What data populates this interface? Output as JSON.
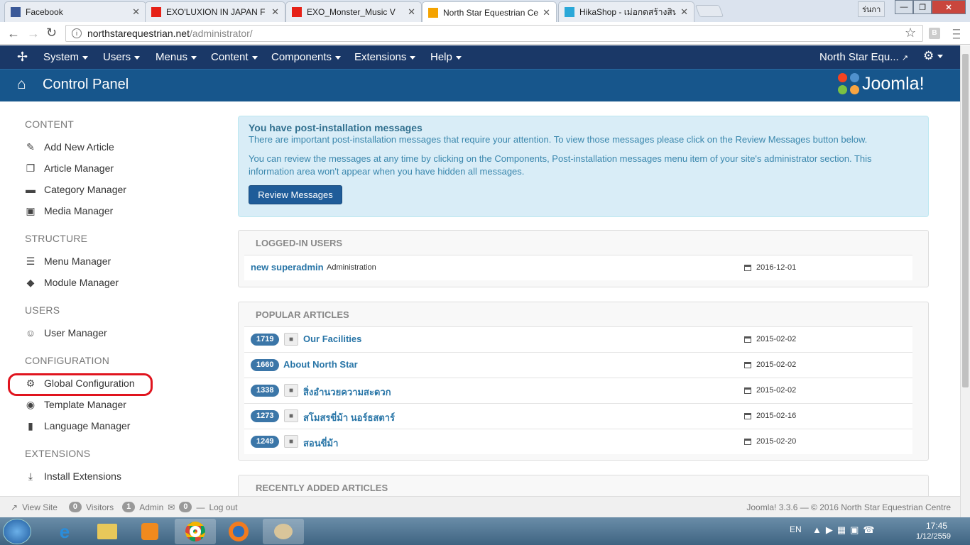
{
  "browser": {
    "tabs": [
      {
        "title": "Facebook",
        "icon": "facebook-icon",
        "color": "#3b5998"
      },
      {
        "title": "EXO'LUXION IN JAPAN F",
        "icon": "youtube-icon",
        "color": "#e62117"
      },
      {
        "title": "EXO_Monster_Music V",
        "icon": "youtube-icon",
        "color": "#e62117"
      },
      {
        "title": "North Star Equestrian Ce",
        "icon": "joomla-icon",
        "color": "#f4a300"
      },
      {
        "title": "HikaShop - เม่อกดสร้างสินค",
        "icon": "hikashop-icon",
        "color": "#2aa8d8"
      }
    ],
    "window_label": "ร่นกา",
    "url": "northstarequestrian.net",
    "url_path": "/administrator/"
  },
  "joomla": {
    "menu": [
      "System",
      "Users",
      "Menus",
      "Content",
      "Components",
      "Extensions",
      "Help"
    ],
    "site_name": "North Star Equ...",
    "page_title": "Control Panel",
    "logo_text": "Joomla!",
    "brand_color": "#1a3867"
  },
  "sidebar": {
    "sections": [
      {
        "heading": "CONTENT",
        "items": [
          {
            "label": "Add New Article",
            "icon": "pencil-icon"
          },
          {
            "label": "Article Manager",
            "icon": "copy-icon"
          },
          {
            "label": "Category Manager",
            "icon": "folder-icon"
          },
          {
            "label": "Media Manager",
            "icon": "image-icon"
          }
        ]
      },
      {
        "heading": "STRUCTURE",
        "items": [
          {
            "label": "Menu Manager",
            "icon": "list-icon"
          },
          {
            "label": "Module Manager",
            "icon": "cube-icon"
          }
        ]
      },
      {
        "heading": "USERS",
        "items": [
          {
            "label": "User Manager",
            "icon": "user-icon"
          }
        ]
      },
      {
        "heading": "CONFIGURATION",
        "items": [
          {
            "label": "Global Configuration",
            "icon": "gear-icon"
          },
          {
            "label": "Template Manager",
            "icon": "eye-icon"
          },
          {
            "label": "Language Manager",
            "icon": "comments-icon"
          }
        ]
      },
      {
        "heading": "EXTENSIONS",
        "items": [
          {
            "label": "Install Extensions",
            "icon": "download-icon"
          }
        ]
      }
    ]
  },
  "alert": {
    "title": "You have post-installation messages",
    "line1": "There are important post-installation messages that require your attention. To view those messages please click on the Review Messages button below.",
    "line2": "You can review the messages at any time by clicking on the Components, Post-installation messages menu item of your site's administrator section. This information area won't appear when you have hidden all messages.",
    "button": "Review Messages"
  },
  "logged_in": {
    "heading": "LOGGED-IN USERS",
    "users": [
      {
        "name": "new superadmin",
        "role": "Administration",
        "date": "2016-12-01"
      }
    ]
  },
  "popular": {
    "heading": "POPULAR ARTICLES",
    "articles": [
      {
        "hits": "1719",
        "title": "Our Facilities",
        "date": "2015-02-02"
      },
      {
        "hits": "1660",
        "title": "About North Star",
        "date": "2015-02-02"
      },
      {
        "hits": "1338",
        "title": "สิ่งอำนวยความสะดวก",
        "date": "2015-02-02"
      },
      {
        "hits": "1273",
        "title": "สโมสรขี่ม้า นอร์ธสตาร์",
        "date": "2015-02-16"
      },
      {
        "hits": "1249",
        "title": "สอนขี่ม้า",
        "date": "2015-02-20"
      }
    ]
  },
  "recent": {
    "heading": "RECENTLY ADDED ARTICLES"
  },
  "footer": {
    "view_site": "View Site",
    "visitors_count": "0",
    "visitors": "Visitors",
    "admin_count": "1",
    "admin": "Admin",
    "msg_count": "0",
    "logout": "Log out",
    "copyright": "Joomla! 3.3.6 — © 2016 North Star Equestrian Centre"
  },
  "taskbar": {
    "lang": "EN",
    "time": "17:45",
    "date": "1/12/2559"
  }
}
